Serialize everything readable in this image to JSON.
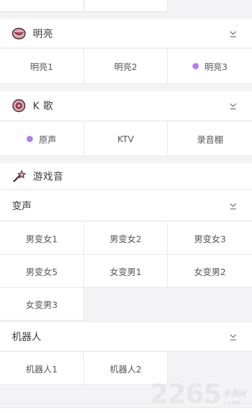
{
  "mingliang": {
    "title": "明亮",
    "items": [
      "明亮1",
      "明亮2",
      "明亮3"
    ]
  },
  "kge": {
    "title": "K 歌",
    "items": [
      "原声",
      "KTV",
      "录音棚"
    ]
  },
  "game": {
    "title": "游戏音"
  },
  "bianshen": {
    "title": "变声",
    "row1": [
      "男变女1",
      "男变女2",
      "男变女3"
    ],
    "row2": [
      "男变女5",
      "女变男1",
      "女变男2"
    ],
    "row3": [
      "女变男3"
    ]
  },
  "robot": {
    "title": "机器人",
    "items": [
      "机器人1",
      "机器人2"
    ]
  },
  "watermark": {
    "number": "2265",
    "site_cn": "手游网",
    "site_domain": ".com"
  },
  "colors": {
    "selected_dot": "#b17df0",
    "icon_pink": "#c0506a",
    "background": "#f3f2f5"
  }
}
